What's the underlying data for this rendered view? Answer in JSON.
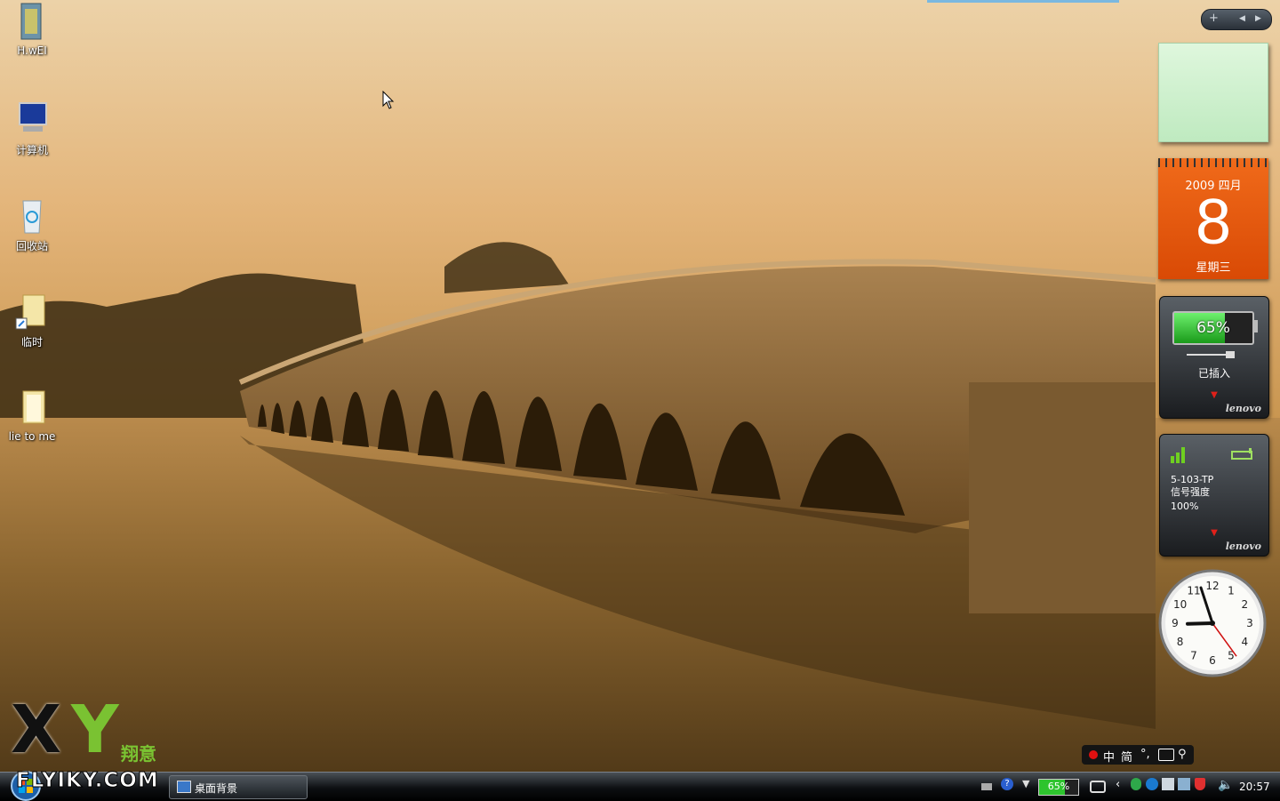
{
  "desktop_icons": [
    {
      "label": "H.wEI",
      "icon": "folder-icon"
    },
    {
      "label": "计算机",
      "icon": "computer-icon"
    },
    {
      "label": "回收站",
      "icon": "recycle-bin-icon"
    },
    {
      "label": "临时",
      "icon": "folder-shortcut-icon"
    },
    {
      "label": "lie to me",
      "icon": "folder-icon"
    }
  ],
  "sidebar": {
    "toolbar": {
      "add": "+",
      "prev": "◀",
      "next": "▶"
    },
    "calendar": {
      "year_month": "2009 四月",
      "day": "8",
      "weekday": "星期三"
    },
    "battery": {
      "percent_label": "65%",
      "level": 0.65,
      "status": "已插入",
      "brand": "lenovo"
    },
    "wifi": {
      "ssid": "5-103-TP",
      "label": "信号强度",
      "strength": "100%",
      "brand": "lenovo"
    },
    "clock": {
      "hour": 8,
      "minute": 57,
      "second": 24
    }
  },
  "language_bar": {
    "chinese": "中",
    "simplified": "简",
    "punct": "°,"
  },
  "watermark": {
    "x": "X",
    "y": "Y",
    "cn": "翔意",
    "site": "FLYIKY.COM"
  },
  "taskbar": {
    "task_label": "桌面背景",
    "tray_battery": "65%",
    "time": "20:57"
  },
  "colors": {
    "sky_top": "#e9c99a",
    "water": "#7a5a2a",
    "calendar": "#e95a10",
    "battery_green": "#2ecc40"
  }
}
